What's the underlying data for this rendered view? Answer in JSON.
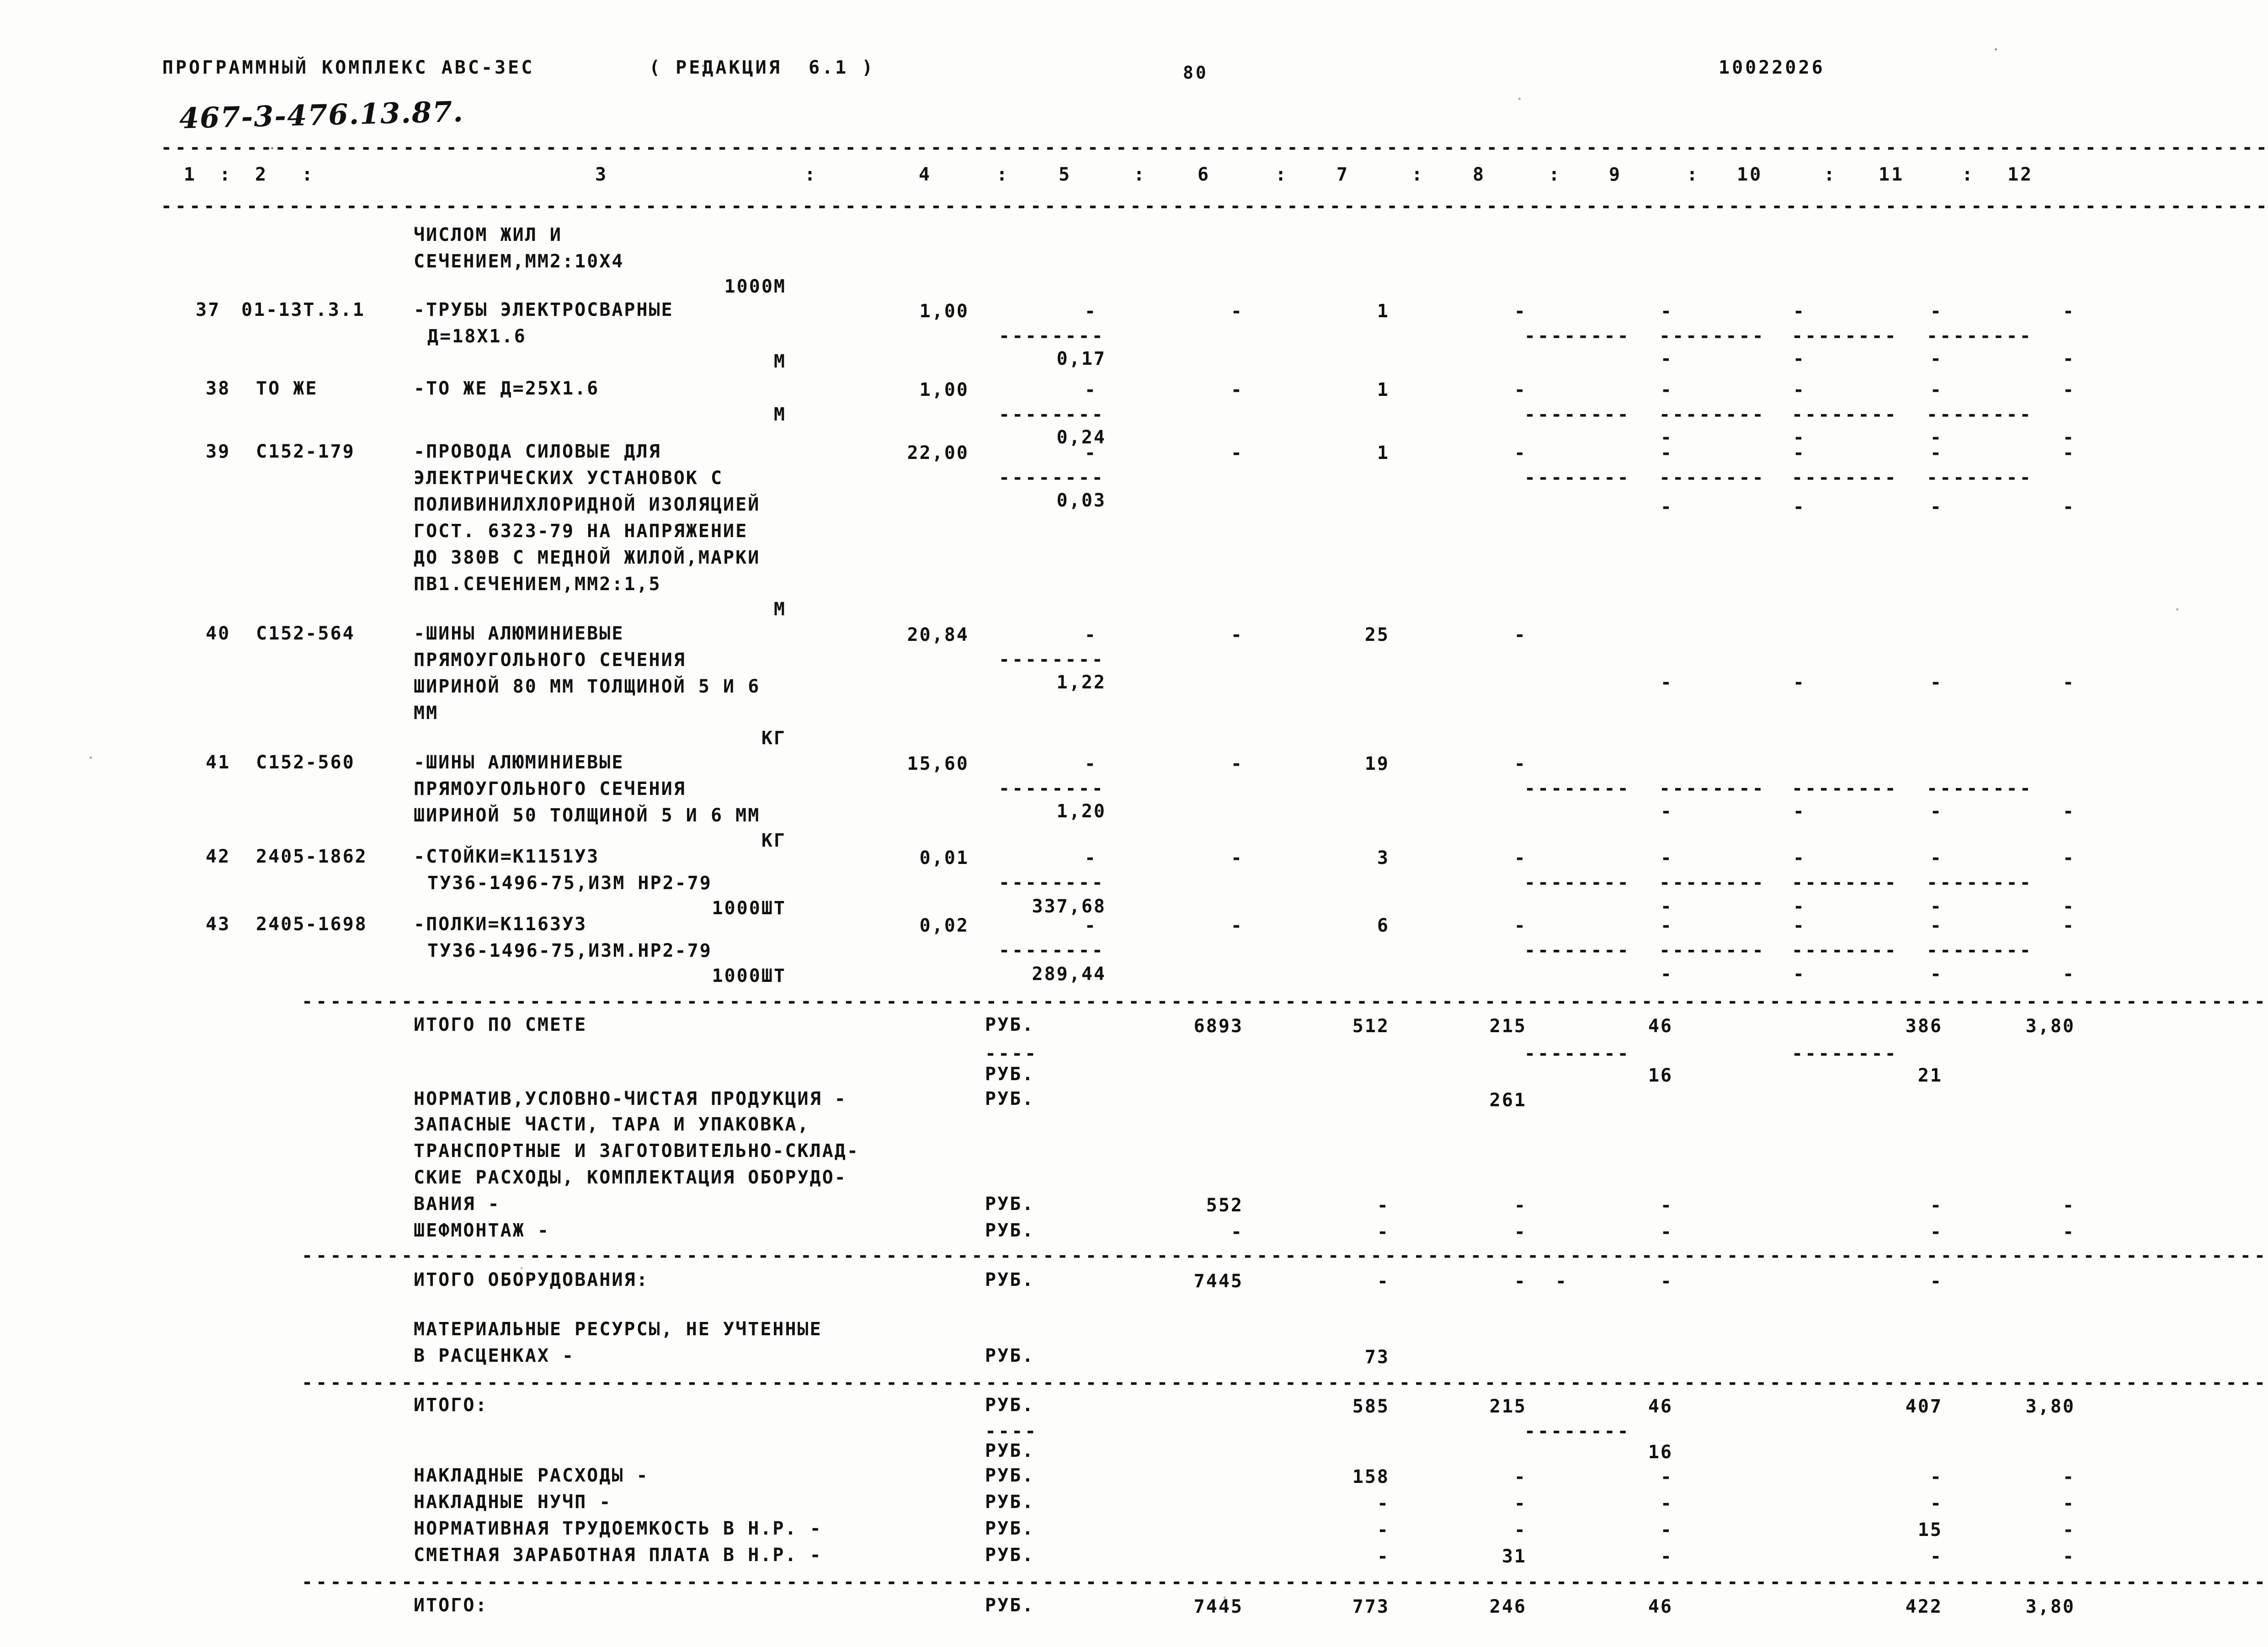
{
  "header": {
    "program": "ПРОГРАММНЫЙ КОМПЛЕКС АВС-3ЕС",
    "edition": "( РЕДАКЦИЯ  6.1 )",
    "page_no": "80",
    "doc_code": "10022026",
    "stamp": "467-3-476.13.87."
  },
  "columns": {
    "numbers": [
      "1",
      "2",
      "3",
      "4",
      "5",
      "6",
      "7",
      "8",
      "9",
      "10",
      "11",
      "12"
    ],
    "sep": ":"
  },
  "rules": {
    "dash_char": "-",
    "long_rule": "--------------------------------------------------------------------------------------------------------------------------------------------------------------------",
    "mid_rule": "--------------------------------------------------------------------------------------------------------------------------------------------------------",
    "seg": "--------",
    "seg_short": "----"
  },
  "continuation": {
    "line1": "ЧИСЛОМ ЖИЛ И",
    "line2": "СЕЧЕНИЕМ,ММ2:10Х4",
    "unit": "1000М"
  },
  "rows": [
    {
      "no": "37",
      "code": "01-13Т.3.1",
      "desc": [
        "-ТРУБЫ ЭЛЕКТРОСВАРНЫЕ",
        "Д=18Х1.6"
      ],
      "unit": "М",
      "qty": "1,00",
      "c5_dash": "-",
      "c5_val": "0,17",
      "c6": "-",
      "c7": "1",
      "c8": "-",
      "c9": "-",
      "c10": "-",
      "c11": "-",
      "c12": "-",
      "seg_row": [
        "c9",
        "c10",
        "c11",
        "c12"
      ]
    },
    {
      "no": "38",
      "code": "ТО ЖЕ",
      "desc": [
        "-ТО ЖЕ Д=25Х1.6"
      ],
      "unit": "М",
      "qty": "1,00",
      "c5_dash": "-",
      "c5_val": "0,24",
      "c6": "-",
      "c7": "1",
      "c8": "-",
      "c9": "-",
      "c10": "-",
      "c11": "-",
      "c12": "-"
    },
    {
      "no": "39",
      "code": "С152-179",
      "desc": [
        "-ПРОВОДА СИЛОВЫЕ ДЛЯ",
        "ЭЛЕКТРИЧЕСКИХ УСТАНОВОК С",
        "ПОЛИВИНИЛХЛОРИДНОЙ ИЗОЛЯЦИЕЙ",
        "ГОСТ. 6323-79 НА НАПРЯЖЕНИЕ",
        "ДО 380В С МЕДНОЙ ЖИЛОЙ,МАРКИ",
        "ПВ1.СЕЧЕНИЕМ,ММ2:1,5"
      ],
      "unit": "М",
      "qty": "22,00",
      "c5_dash": "-",
      "c5_val": "0,03",
      "c6": "-",
      "c7": "1",
      "c8": "-",
      "c9": "-",
      "c10": "-",
      "c11": "-",
      "c12": "-"
    },
    {
      "no": "40",
      "code": "С152-564",
      "desc": [
        "-ШИНЫ АЛЮМИНИЕВЫЕ",
        "ПРЯМОУГОЛЬНОГО СЕЧЕНИЯ",
        "ШИРИНОЙ 80 ММ ТОЛЩИНОЙ 5 И 6",
        "ММ"
      ],
      "unit": "КГ",
      "qty": "20,84",
      "c5_dash": "-",
      "c5_val": "1,22",
      "c6": "-",
      "c7": "25",
      "c8": "-",
      "c9": "-",
      "c10": "-",
      "c11": "-",
      "c12": "-"
    },
    {
      "no": "41",
      "code": "С152-560",
      "desc": [
        "-ШИНЫ АЛЮМИНИЕВЫЕ",
        "ПРЯМОУГОЛЬНОГО СЕЧЕНИЯ",
        "ШИРИНОЙ 50 ТОЛЩИНОЙ 5 И 6 ММ"
      ],
      "unit": "КГ",
      "qty": "15,60",
      "c5_dash": "-",
      "c5_val": "1,20",
      "c6": "-",
      "c7": "19",
      "c8": "-",
      "c9": "-",
      "c10": "-",
      "c11": "-",
      "c12": "-"
    },
    {
      "no": "42",
      "code": "2405-1862",
      "desc": [
        "-СТОЙКИ=К1151У3",
        "ТУ36-1496-75,ИЗМ НР2-79"
      ],
      "unit": "1000ШТ",
      "qty": "0,01",
      "c5_dash": "-",
      "c5_val": "337,68",
      "c6": "-",
      "c7": "3",
      "c8": "-",
      "c9": "-",
      "c10": "-",
      "c11": "-",
      "c12": "-"
    },
    {
      "no": "43",
      "code": "2405-1698",
      "desc": [
        "-ПОЛКИ=К1163У3",
        "ТУ36-1496-75,ИЗМ.НР2-79"
      ],
      "unit": "1000ШТ",
      "qty": "0,02",
      "c5_dash": "-",
      "c5_val": "289,44",
      "c6": "-",
      "c7": "6",
      "c8": "-",
      "c9": "-",
      "c10": "-",
      "c11": "-",
      "c12": "-"
    }
  ],
  "totals": {
    "currency": "РУБ.",
    "itogo_po_smete": {
      "label": "ИТОГО ПО СМЕТЕ",
      "c6": "6893",
      "c7": "512",
      "c8": "215",
      "c9": "46",
      "c11": "386",
      "c12": "3,80"
    },
    "itogo_sub": {
      "c9": "16",
      "c11": "21"
    },
    "normativ": {
      "label": "НОРМАТИВ,УСЛОВНО-ЧИСТАЯ ПРОДУКЦИЯ -",
      "c8": "261"
    },
    "zapchasti": {
      "lines": [
        "ЗАПАСНЫЕ ЧАСТИ, ТАРА И УПАКОВКА,",
        "ТРАНСПОРТНЫЕ И ЗАГОТОВИТЕЛЬНО-СКЛАД-",
        "СКИЕ РАСХОДЫ, КОМПЛЕКТАЦИЯ ОБОРУДО-",
        "ВАНИЯ -"
      ],
      "c6": "552",
      "c7": "-",
      "c8": "-",
      "c9": "-",
      "c11": "-",
      "c12": "-"
    },
    "shefmontazh": {
      "label": "ШЕФМОНТАЖ -",
      "c6": "-",
      "c7": "-",
      "c8": "-",
      "c9": "-",
      "c11": "-",
      "c12": "-"
    },
    "itogo_oborud": {
      "label": "ИТОГО ОБОРУДОВАНИЯ:",
      "c6": "7445",
      "c7": "-",
      "c8": "-",
      "c8b": "-",
      "c9": "-",
      "c11": "-"
    },
    "material": {
      "lines": [
        "МАТЕРИАЛЬНЫЕ РЕСУРСЫ, НЕ УЧТЕННЫЕ",
        "В РАСЦЕНКАХ -"
      ],
      "c7": "73"
    },
    "itogo": {
      "label": "ИТОГО:",
      "c7": "585",
      "c8": "215",
      "c9": "46",
      "c11": "407",
      "c12": "3,80"
    },
    "itogo2_sub": {
      "c9": "16"
    },
    "nakladnye_rashody": {
      "label": "НАКЛАДНЫЕ РАСХОДЫ -",
      "c7": "158",
      "c8": "-",
      "c9": "-",
      "c11": "-",
      "c12": "-"
    },
    "nakladnye_nuchp": {
      "label": "НАКЛАДНЫЕ НУЧП -",
      "c7": "-",
      "c8": "-",
      "c9": "-",
      "c11": "-",
      "c12": "-"
    },
    "trudoemkost": {
      "label": "НОРМАТИВНАЯ ТРУДОЕМКОСТЬ В Н.Р. -",
      "c7": "-",
      "c8": "-",
      "c9": "-",
      "c11": "15",
      "c12": "-"
    },
    "zarplata": {
      "label": "СМЕТНАЯ ЗАРАБОТНАЯ ПЛАТА В Н.Р. -",
      "c7": "-",
      "c8": "31",
      "c9": "-",
      "c11": "-",
      "c12": "-"
    },
    "itogo_final": {
      "label": "ИТОГО:",
      "c6": "7445",
      "c7": "773",
      "c8": "246",
      "c9": "46",
      "c11": "422",
      "c12": "3,80"
    }
  }
}
